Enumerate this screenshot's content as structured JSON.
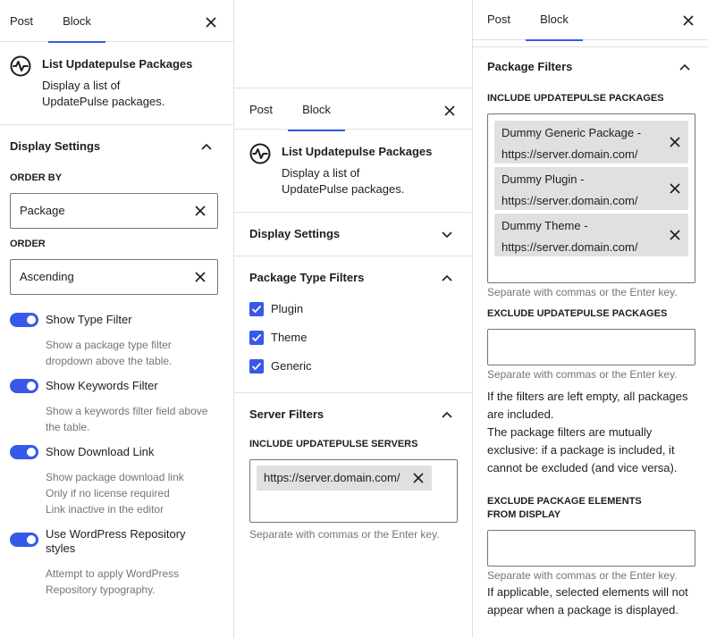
{
  "panel1": {
    "tabs": {
      "post": "Post",
      "block": "Block"
    },
    "block": {
      "title": "List Updatepulse Packages",
      "description": "Display a list of UpdatePulse packages."
    },
    "display_settings": {
      "title": "Display Settings",
      "order_by_label": "ORDER BY",
      "order_by_value": "Package",
      "order_label": "ORDER",
      "order_value": "Ascending",
      "toggles": [
        {
          "label": "Show Type Filter",
          "help": "Show a package type filter dropdown above the table.",
          "on": true
        },
        {
          "label": "Show Keywords Filter",
          "help": "Show a keywords filter field above the table.",
          "on": true
        },
        {
          "label": "Show Download Link",
          "help": "Show package download link Only if no license required Link inactive in the editor",
          "on": true
        },
        {
          "label": "Use WordPress Repository styles",
          "help": "Attempt to apply WordPress Repository typography.",
          "on": true
        }
      ]
    }
  },
  "panel2": {
    "tabs": {
      "post": "Post",
      "block": "Block"
    },
    "block": {
      "title": "List Updatepulse Packages",
      "description": "Display a list of UpdatePulse packages."
    },
    "display_settings_title": "Display Settings",
    "package_type_filters": {
      "title": "Package Type Filters",
      "options": [
        "Plugin",
        "Theme",
        "Generic"
      ]
    },
    "server_filters": {
      "title": "Server Filters",
      "include_label": "INCLUDE UPDATEPULSE SERVERS",
      "tokens": [
        "https://server.domain.com/"
      ],
      "help": "Separate with commas or the Enter key."
    }
  },
  "panel3": {
    "tabs": {
      "post": "Post",
      "block": "Block"
    },
    "package_filters": {
      "title": "Package Filters",
      "include_label": "INCLUDE UPDATEPULSE PACKAGES",
      "tokens": [
        "Dummy Generic Package - https://server.domain.com/",
        "Dummy Plugin - https://server.domain.com/",
        "Dummy Theme - https://server.domain.com/"
      ],
      "include_help": "Separate with commas or the Enter key.",
      "exclude_label": "EXCLUDE UPDATEPULSE PACKAGES",
      "exclude_help": "Separate with commas or the Enter key.",
      "note1": "If the filters are left empty, all packages are included.",
      "note2": "The package filters are mutually exclusive: if a package is included, it cannot be excluded (and vice versa).",
      "exclude_elements_label": "EXCLUDE PACKAGE ELEMENTS FROM DISPLAY",
      "exclude_elements_help": "Separate with commas or the Enter key.",
      "exclude_elements_note": "If applicable, selected elements will not appear when a package is displayed."
    }
  },
  "colors": {
    "accent": "#3858e9",
    "border": "#757575",
    "divider": "#e0e0e0",
    "token_bg": "#e0e0e0",
    "help_text": "#757575"
  }
}
